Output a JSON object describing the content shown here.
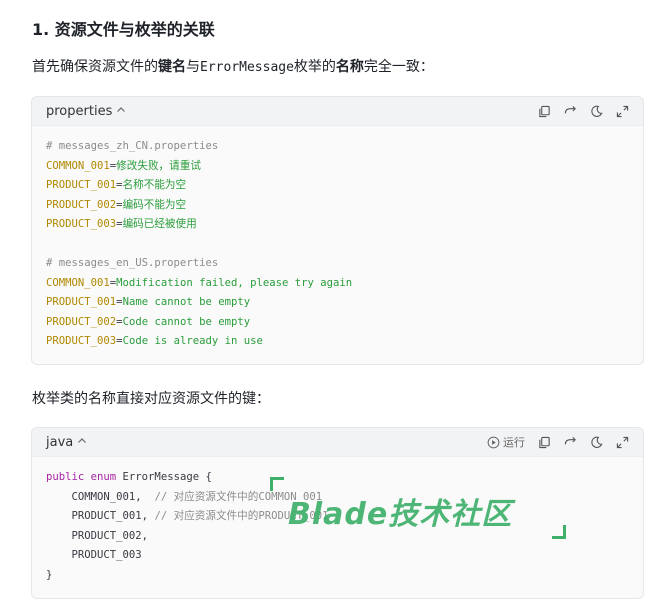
{
  "section": {
    "heading": "1. 资源文件与枚举的关联"
  },
  "intro": {
    "part1": "首先确保资源文件的",
    "bold1": "键名",
    "part2": "与",
    "code": "ErrorMessage",
    "part3": "枚举的",
    "bold2": "名称",
    "part4": "完全一致："
  },
  "block1": {
    "language": "properties",
    "lines": [
      {
        "comment": "# messages_zh_CN.properties"
      },
      {
        "key": "COMMON_001",
        "value": "修改失败，请重试"
      },
      {
        "key": "PRODUCT_001",
        "value": "名称不能为空"
      },
      {
        "key": "PRODUCT_002",
        "value": "编码不能为空"
      },
      {
        "key": "PRODUCT_003",
        "value": "编码已经被使用"
      },
      {
        "blank": ""
      },
      {
        "comment": "# messages_en_US.properties"
      },
      {
        "key": "COMMON_001",
        "value": "Modification failed, please try again"
      },
      {
        "key": "PRODUCT_001",
        "value": "Name cannot be empty"
      },
      {
        "key": "PRODUCT_002",
        "value": "Code cannot be empty"
      },
      {
        "key": "PRODUCT_003",
        "value": "Code is already in use"
      }
    ]
  },
  "middle_text": "枚举类的名称直接对应资源文件的键：",
  "block2": {
    "language": "java",
    "run_label": "运行",
    "lines": [
      {
        "kw": "public enum ",
        "plain": "ErrorMessage {"
      },
      {
        "plain": "    COMMON_001,  ",
        "comment": "// 对应资源文件中的COMMON_001"
      },
      {
        "plain": "    PRODUCT_001, ",
        "comment": "// 对应资源文件中的PRODUCT_001"
      },
      {
        "plain": "    PRODUCT_002,"
      },
      {
        "plain": "    PRODUCT_003"
      },
      {
        "plain": "}"
      }
    ]
  },
  "watermark": {
    "text": "Blade技术社区",
    "color": "#3fb06a"
  },
  "icons": [
    "chevron-up-icon",
    "copy-icon",
    "wrap-icon",
    "theme-icon",
    "expand-icon",
    "play-icon"
  ]
}
